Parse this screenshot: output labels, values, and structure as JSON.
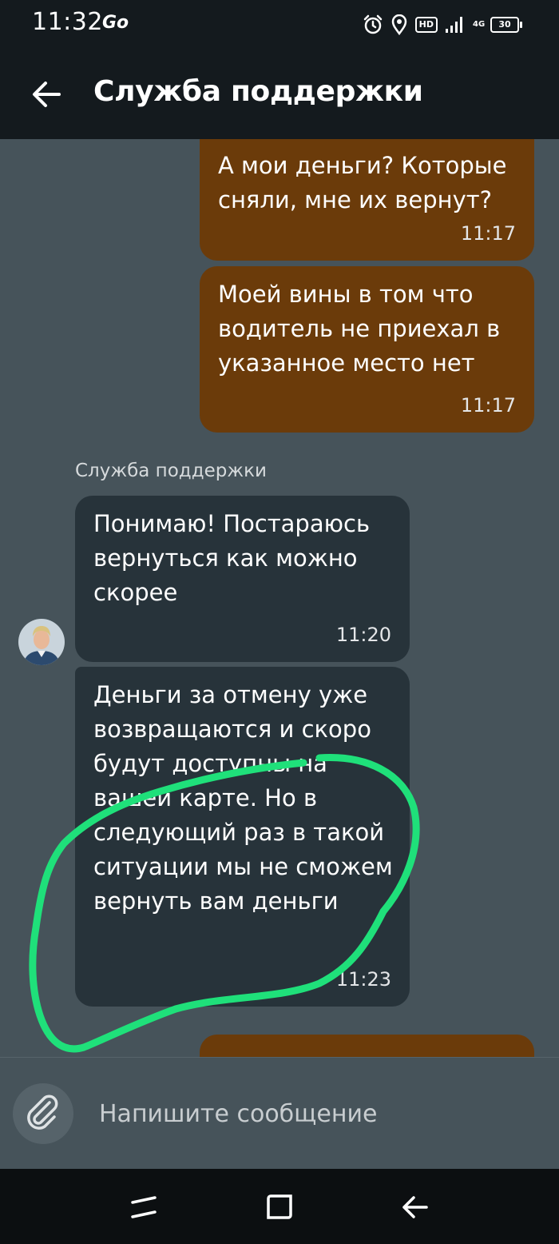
{
  "status_bar": {
    "time": "11:32",
    "app_logo": "Go",
    "hd_label": "HD",
    "network_label": "4G",
    "battery_level": "30",
    "icons": [
      "alarm-icon",
      "location-icon",
      "signal-icon",
      "battery-icon"
    ]
  },
  "header": {
    "title": "Служба поддержки",
    "back_icon": "arrow-left-icon"
  },
  "messages": [
    {
      "direction": "out",
      "text": "А мои деньги? Которые сняли, мне их вернут?",
      "time": "11:17"
    },
    {
      "direction": "out",
      "text": "Моей вины в том что водитель не приехал в указанное место нет",
      "time": "11:17"
    },
    {
      "direction": "in",
      "text": "Понимаю! Постараюсь вернуться как можно скорее",
      "time": "11:20"
    },
    {
      "direction": "in",
      "text": "Деньги за отмену уже возвращаются и скоро будут доступны на вашей карте. Но в следующий раз в такой ситуации мы не сможем вернуть вам деньги",
      "time": "11:23"
    }
  ],
  "sender_name": "Служба поддержки",
  "composer": {
    "placeholder": "Напишите сообщение",
    "attach_icon": "paperclip-icon"
  },
  "nav": {
    "icons": [
      "recent-apps-icon",
      "home-icon",
      "back-icon"
    ]
  },
  "colors": {
    "header_bg": "#141a1e",
    "chat_bg": "#46535a",
    "outgoing_bubble": "#6b3b0a",
    "incoming_bubble": "#27333a",
    "highlight_marker": "#1fe07a"
  }
}
